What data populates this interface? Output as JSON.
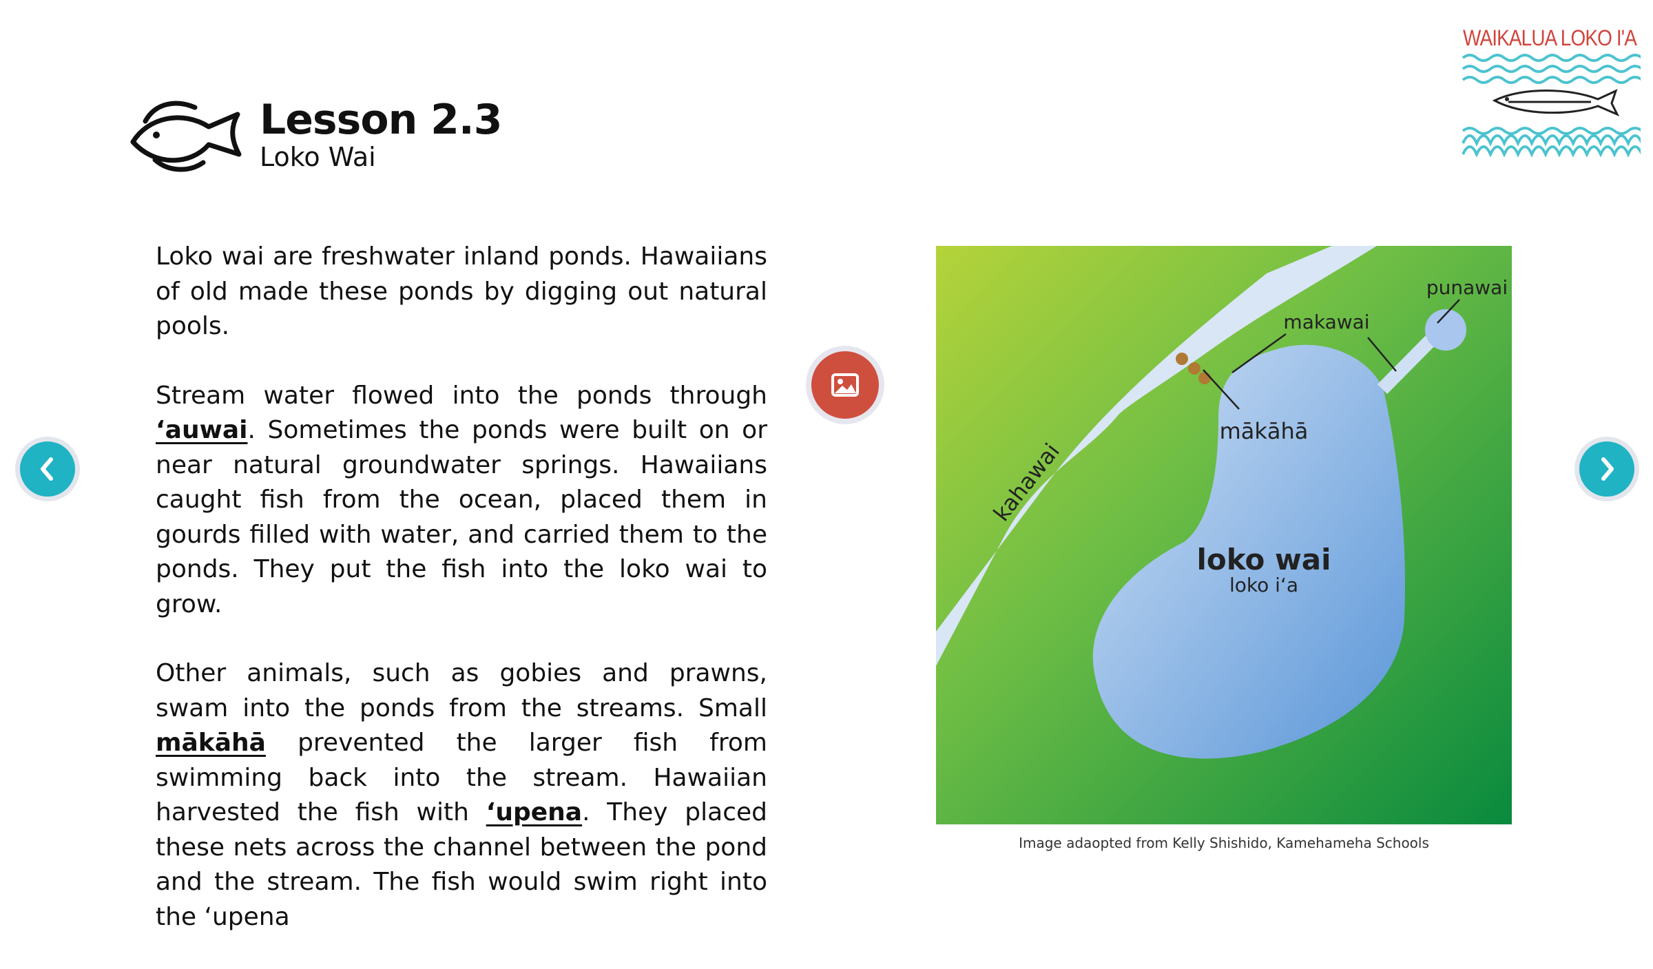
{
  "header": {
    "lesson_title": "Lesson 2.3",
    "lesson_subtitle": "Loko Wai",
    "icon": "fish-icon"
  },
  "logo": {
    "text": "WAIKALUA LOKO I'A",
    "icon": "waikalua-logo",
    "colors": {
      "text": "#d0453d",
      "waves": "#4cc3cf"
    }
  },
  "body": {
    "paragraphs": [
      {
        "text": "Loko wai are freshwater inland ponds. Hawaiians of old made these ponds by digging out natural pools."
      },
      {
        "before": "Stream water flowed into the ponds through ",
        "term": "ʻauwai",
        "after": ". Sometimes the ponds were built on or near natural groundwater springs. Hawaiians caught fish from the ocean, placed them in gourds filled with water, and carried them to the ponds. They put the fish into the loko wai to grow."
      },
      {
        "before": "Other animals, such as gobies and prawns, swam into the ponds from the streams. Small ",
        "term": "mākāhā",
        "middle": " prevented the larger fish from swimming back into the stream. Hawaiian harvested the fish with ",
        "term2": "ʻupena",
        "after": ". They placed these nets across the channel between the pond and the stream. The fish would swim right into the ʻupena"
      }
    ]
  },
  "diagram": {
    "labels": {
      "kahawai": "kahawai",
      "punawai": "punawai",
      "makawai": "makawai",
      "makaha": "mākāhā",
      "loko_wai": "loko wai",
      "loko_ia": "loko iʻa"
    },
    "caption": "Image adaopted from Kelly Shishido, Kamehameha Schools"
  },
  "controls": {
    "prev_icon": "chevron-left-icon",
    "next_icon": "chevron-right-icon",
    "image_icon": "image-icon"
  },
  "colors": {
    "accent": "#1fb3c4",
    "image_button": "#cf4f3e",
    "grass_light": "#b5d33a",
    "grass_dark": "#098a3e",
    "water_light": "#cfe0f5",
    "water_dark": "#5a96d8",
    "stream": "#d9e6f6"
  }
}
